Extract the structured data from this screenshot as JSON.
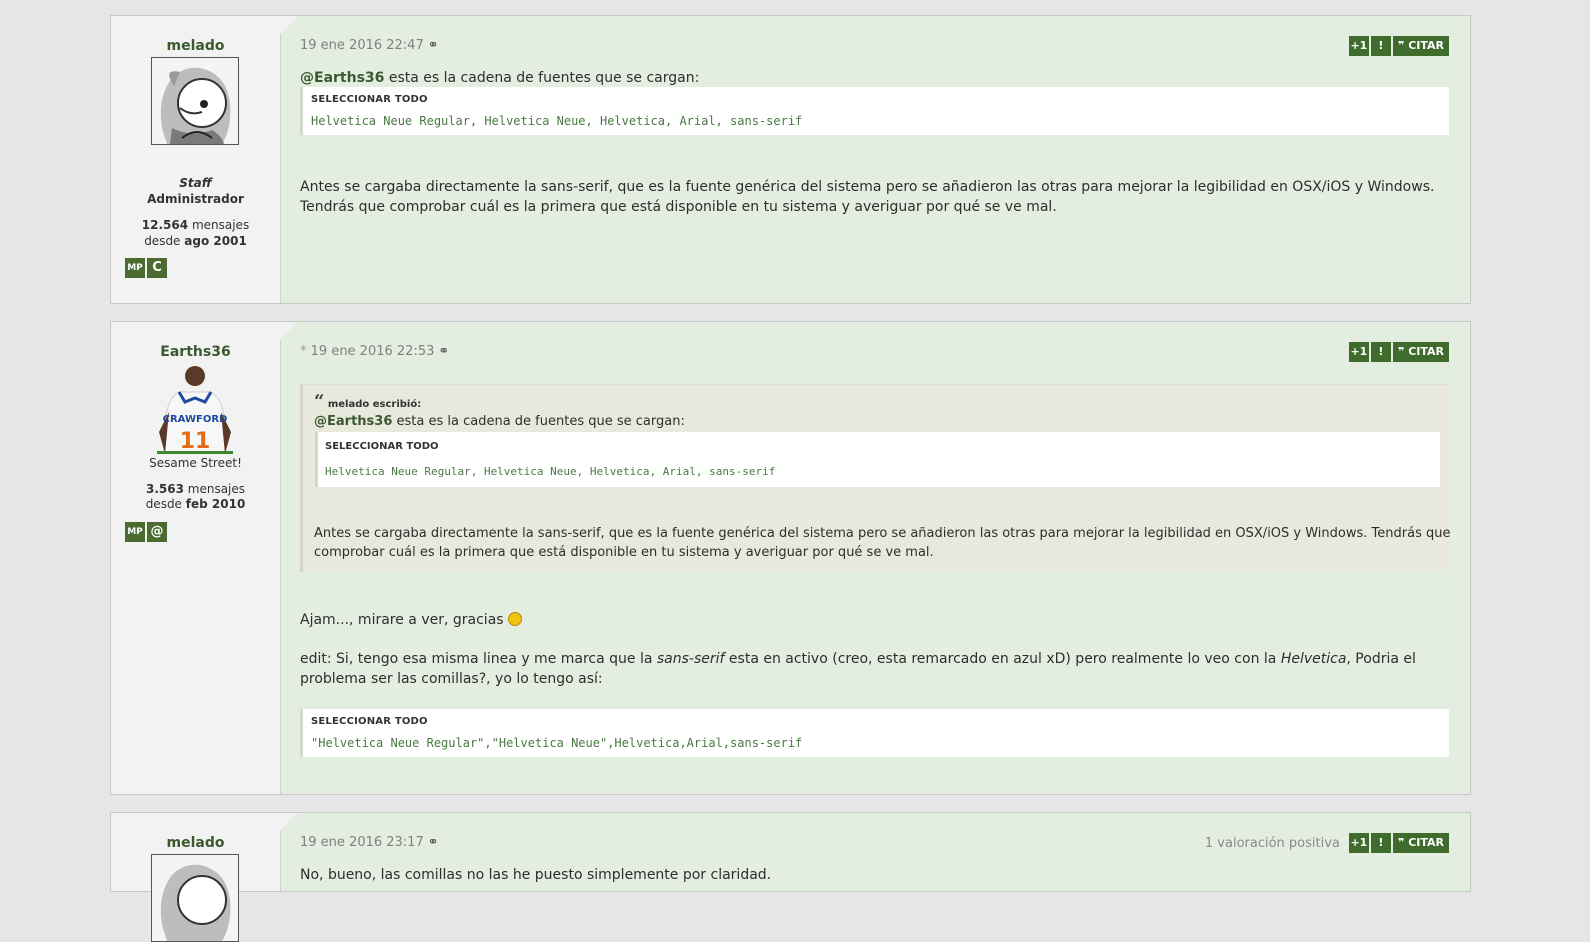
{
  "posts": [
    {
      "author": "melado",
      "title": "Staff",
      "role": "Administrador",
      "messages_count": "12.564",
      "messages_label": "mensajes",
      "since_label": "desde",
      "since_date": "ago 2001",
      "badge_mp": "MP",
      "date": "19 ene 2016 22:47",
      "mention": "@Earths36",
      "intro": " esta es la cadena de fuentes que se cargan:",
      "code_header": "SELECCIONAR TODO",
      "code_body": "Helvetica Neue Regular, Helvetica Neue, Helvetica, Arial, sans-serif",
      "body_line1": "Antes se cargaba directamente la sans-serif, que es la fuente genérica del sistema pero se añadieron las otras para mejorar la legibilidad en OSX/iOS y Windows.",
      "body_line2": "Tendrás que comprobar cuál es la primera que está disponible en tu sistema y averiguar por qué se ve mal.",
      "btn_plus": "+1",
      "btn_report": "!",
      "btn_quote": "CITAR"
    },
    {
      "author": "Earths36",
      "user_title": "Sesame Street!",
      "messages_count": "3.563",
      "messages_label": "mensajes",
      "since_label": "desde",
      "since_date": "feb 2010",
      "badge_mp": "MP",
      "badge_at": "@",
      "edited_mark": "*",
      "date": "19 ene 2016 22:53",
      "quote_author": "melado escribió:",
      "quote_mention": "@Earths36",
      "quote_intro": " esta es la cadena de fuentes que se cargan:",
      "quote_code_header": "SELECCIONAR TODO",
      "quote_code_body": "Helvetica Neue Regular, Helvetica Neue, Helvetica, Arial, sans-serif",
      "quote_body_line1": "Antes se cargaba directamente la sans-serif, que es la fuente genérica del sistema pero se añadieron las otras para mejorar la legibilidad en OSX/iOS y Windows. Tendrás que",
      "quote_body_line2": "comprobar cuál es la primera que está disponible en tu sistema y averiguar por qué se ve mal.",
      "reply_line": "Ajam..., mirare a ver, gracias",
      "edit_p1": "edit: Si, tengo esa misma linea y me marca que la ",
      "edit_em1": "sans-serif",
      "edit_p2": " esta en activo (creo, esta remarcado en azul xD) pero realmente lo veo con la ",
      "edit_em2": "Helvetica",
      "edit_p3": ", Podria el",
      "edit_line2": "problema ser las comillas?, yo lo tengo así:",
      "code_header": "SELECCIONAR TODO",
      "code_body": "\"Helvetica Neue Regular\",\"Helvetica Neue\",Helvetica,Arial,sans-serif",
      "btn_plus": "+1",
      "btn_report": "!",
      "btn_quote": "CITAR"
    },
    {
      "author": "melado",
      "date": "19 ene 2016 23:17",
      "rating": "1 valoración positiva",
      "body": "No, bueno, las comillas no las he puesto simplemente por claridad.",
      "btn_plus": "+1",
      "btn_report": "!",
      "btn_quote": "CITAR"
    }
  ],
  "colors": {
    "accent": "#3f6b2d",
    "post_bg": "#e3ede0",
    "sidebar_bg": "#f2f2f2",
    "quote_bg": "#e8e8dc"
  }
}
